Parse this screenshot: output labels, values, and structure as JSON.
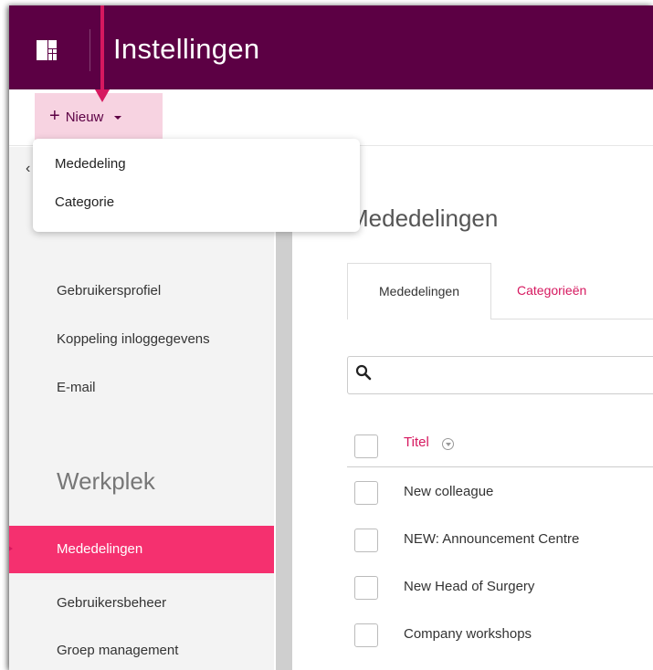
{
  "header": {
    "title": "Instellingen"
  },
  "toolbar": {
    "new_label": "Nieuw",
    "new_plus": "+"
  },
  "dropdown": {
    "items": [
      "Mededeling",
      "Categorie"
    ]
  },
  "sidebar": {
    "collapse_glyph": "‹",
    "items_top": [
      "Gebruikersprofiel",
      "Koppeling inloggegevens",
      "E-mail"
    ],
    "section_heading": "Werkplek",
    "items_workplace": [
      "Mededelingen",
      "Gebruikersbeheer",
      "Groep management"
    ],
    "active_item": "Mededelingen"
  },
  "main": {
    "title": "Mededelingen",
    "tabs": [
      {
        "label": "Mededelingen",
        "active": true
      },
      {
        "label": "Categorieën",
        "active": false
      }
    ],
    "search": {
      "placeholder": "",
      "icon": "search-icon"
    },
    "table": {
      "columns": [
        "Titel"
      ],
      "rows": [
        "New colleague",
        "NEW: Announcement Centre",
        "New Head of Surgery",
        "Company workshops"
      ]
    }
  },
  "colors": {
    "topbar": "#5c0044",
    "accent": "#f5306f",
    "link": "#d6185f",
    "button_bg": "#f7d3e1"
  }
}
